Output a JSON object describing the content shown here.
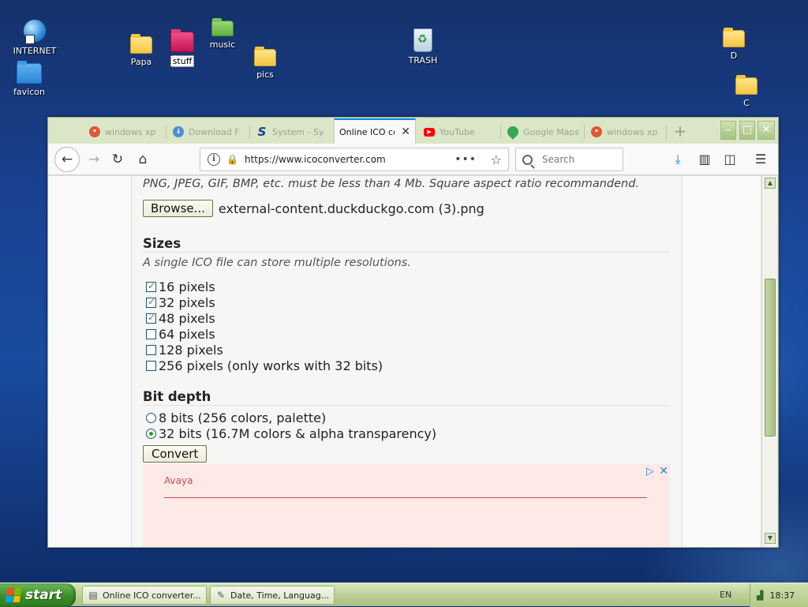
{
  "desktop": {
    "icons": [
      {
        "label": "INTERNET"
      },
      {
        "label": "favicon"
      },
      {
        "label": "Papa"
      },
      {
        "label": "stuff"
      },
      {
        "label": "music"
      },
      {
        "label": "pics"
      },
      {
        "label": "TRASH"
      },
      {
        "label": "D"
      },
      {
        "label": "C"
      }
    ]
  },
  "browser": {
    "tabs": [
      {
        "label": "windows xp",
        "icon": "duckduckgo-icon",
        "color": "#de5833"
      },
      {
        "label": "Download F",
        "icon": "download-site-icon",
        "color": "#4a8fd6"
      },
      {
        "label": "System - Sy",
        "icon": "s-logo-icon",
        "color": "#1b3f8f"
      },
      {
        "label": "Online ICO co",
        "icon": "none",
        "active": true
      },
      {
        "label": "YouTube",
        "icon": "youtube-icon",
        "color": "#ff0000"
      },
      {
        "label": "Google Maps",
        "icon": "google-maps-icon",
        "color": "#34a853"
      },
      {
        "label": "windows xp",
        "icon": "duckduckgo-icon",
        "color": "#de5833"
      }
    ],
    "url": "https://www.icoconverter.com",
    "search_placeholder": "Search",
    "accent_color": "#0a84ff"
  },
  "page": {
    "hint": "PNG, JPEG, GIF, BMP, etc. must be less than 4 Mb. Square aspect ratio recommandend.",
    "browse_label": "Browse...",
    "filename": "external-content.duckduckgo.com (3).png",
    "sizes": {
      "title": "Sizes",
      "description": "A single ICO file can store multiple resolutions.",
      "options": [
        {
          "label": "16 pixels",
          "checked": true
        },
        {
          "label": "32 pixels",
          "checked": true
        },
        {
          "label": "48 pixels",
          "checked": true
        },
        {
          "label": "64 pixels",
          "checked": false
        },
        {
          "label": "128 pixels",
          "checked": false
        },
        {
          "label": "256 pixels (only works with 32 bits)",
          "checked": false
        }
      ]
    },
    "bitdepth": {
      "title": "Bit depth",
      "options": [
        {
          "label": "8 bits (256 colors, palette)",
          "selected": false
        },
        {
          "label": "32 bits (16.7M colors & alpha transparency)",
          "selected": true
        }
      ]
    },
    "convert_label": "Convert",
    "ad": {
      "name": "Avaya"
    }
  },
  "taskbar": {
    "start_label": "start",
    "buttons": [
      {
        "label": "Online ICO converter..."
      },
      {
        "label": "Date, Time, Languag..."
      }
    ],
    "language": "EN",
    "clock": "18:37"
  }
}
